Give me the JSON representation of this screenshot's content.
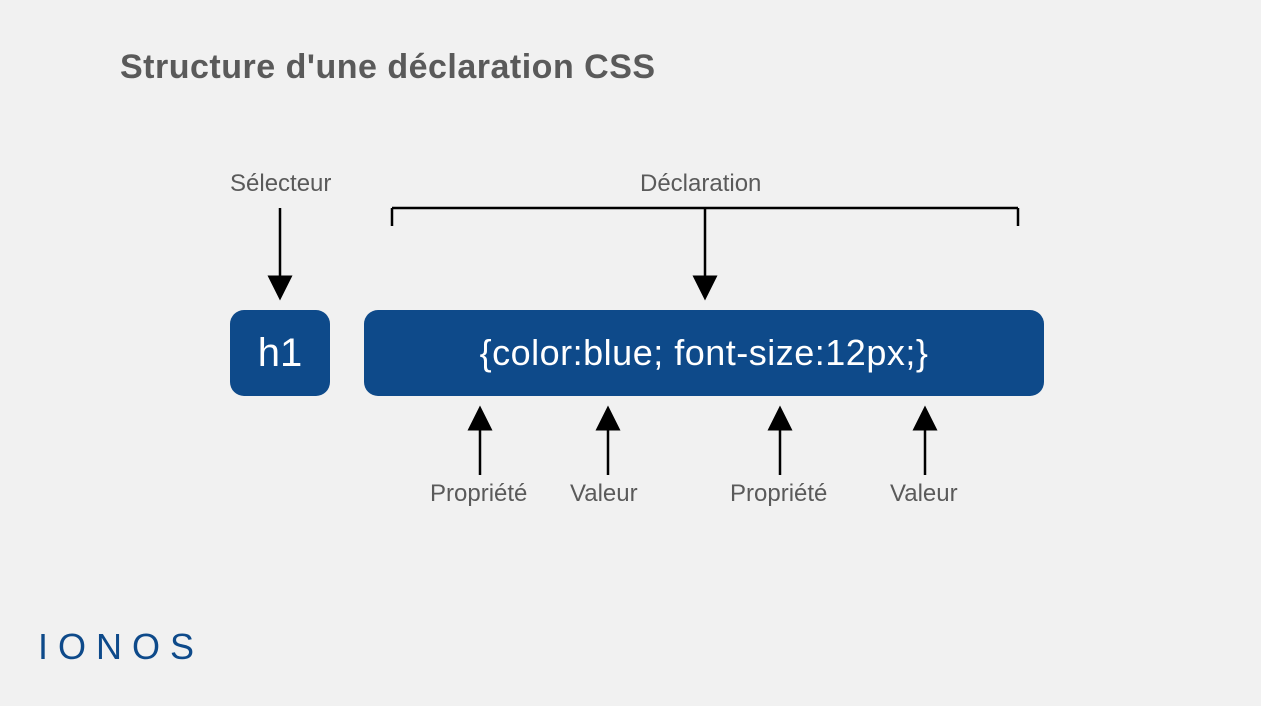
{
  "title": "Structure d'une déclaration CSS",
  "labels": {
    "selector": "Sélecteur",
    "declaration": "Déclaration",
    "property1": "Propriété",
    "value1": "Valeur",
    "property2": "Propriété",
    "value2": "Valeur"
  },
  "code": {
    "selector": "h1",
    "declaration": "{color:blue; font-size:12px;}"
  },
  "brand": "IONOS"
}
